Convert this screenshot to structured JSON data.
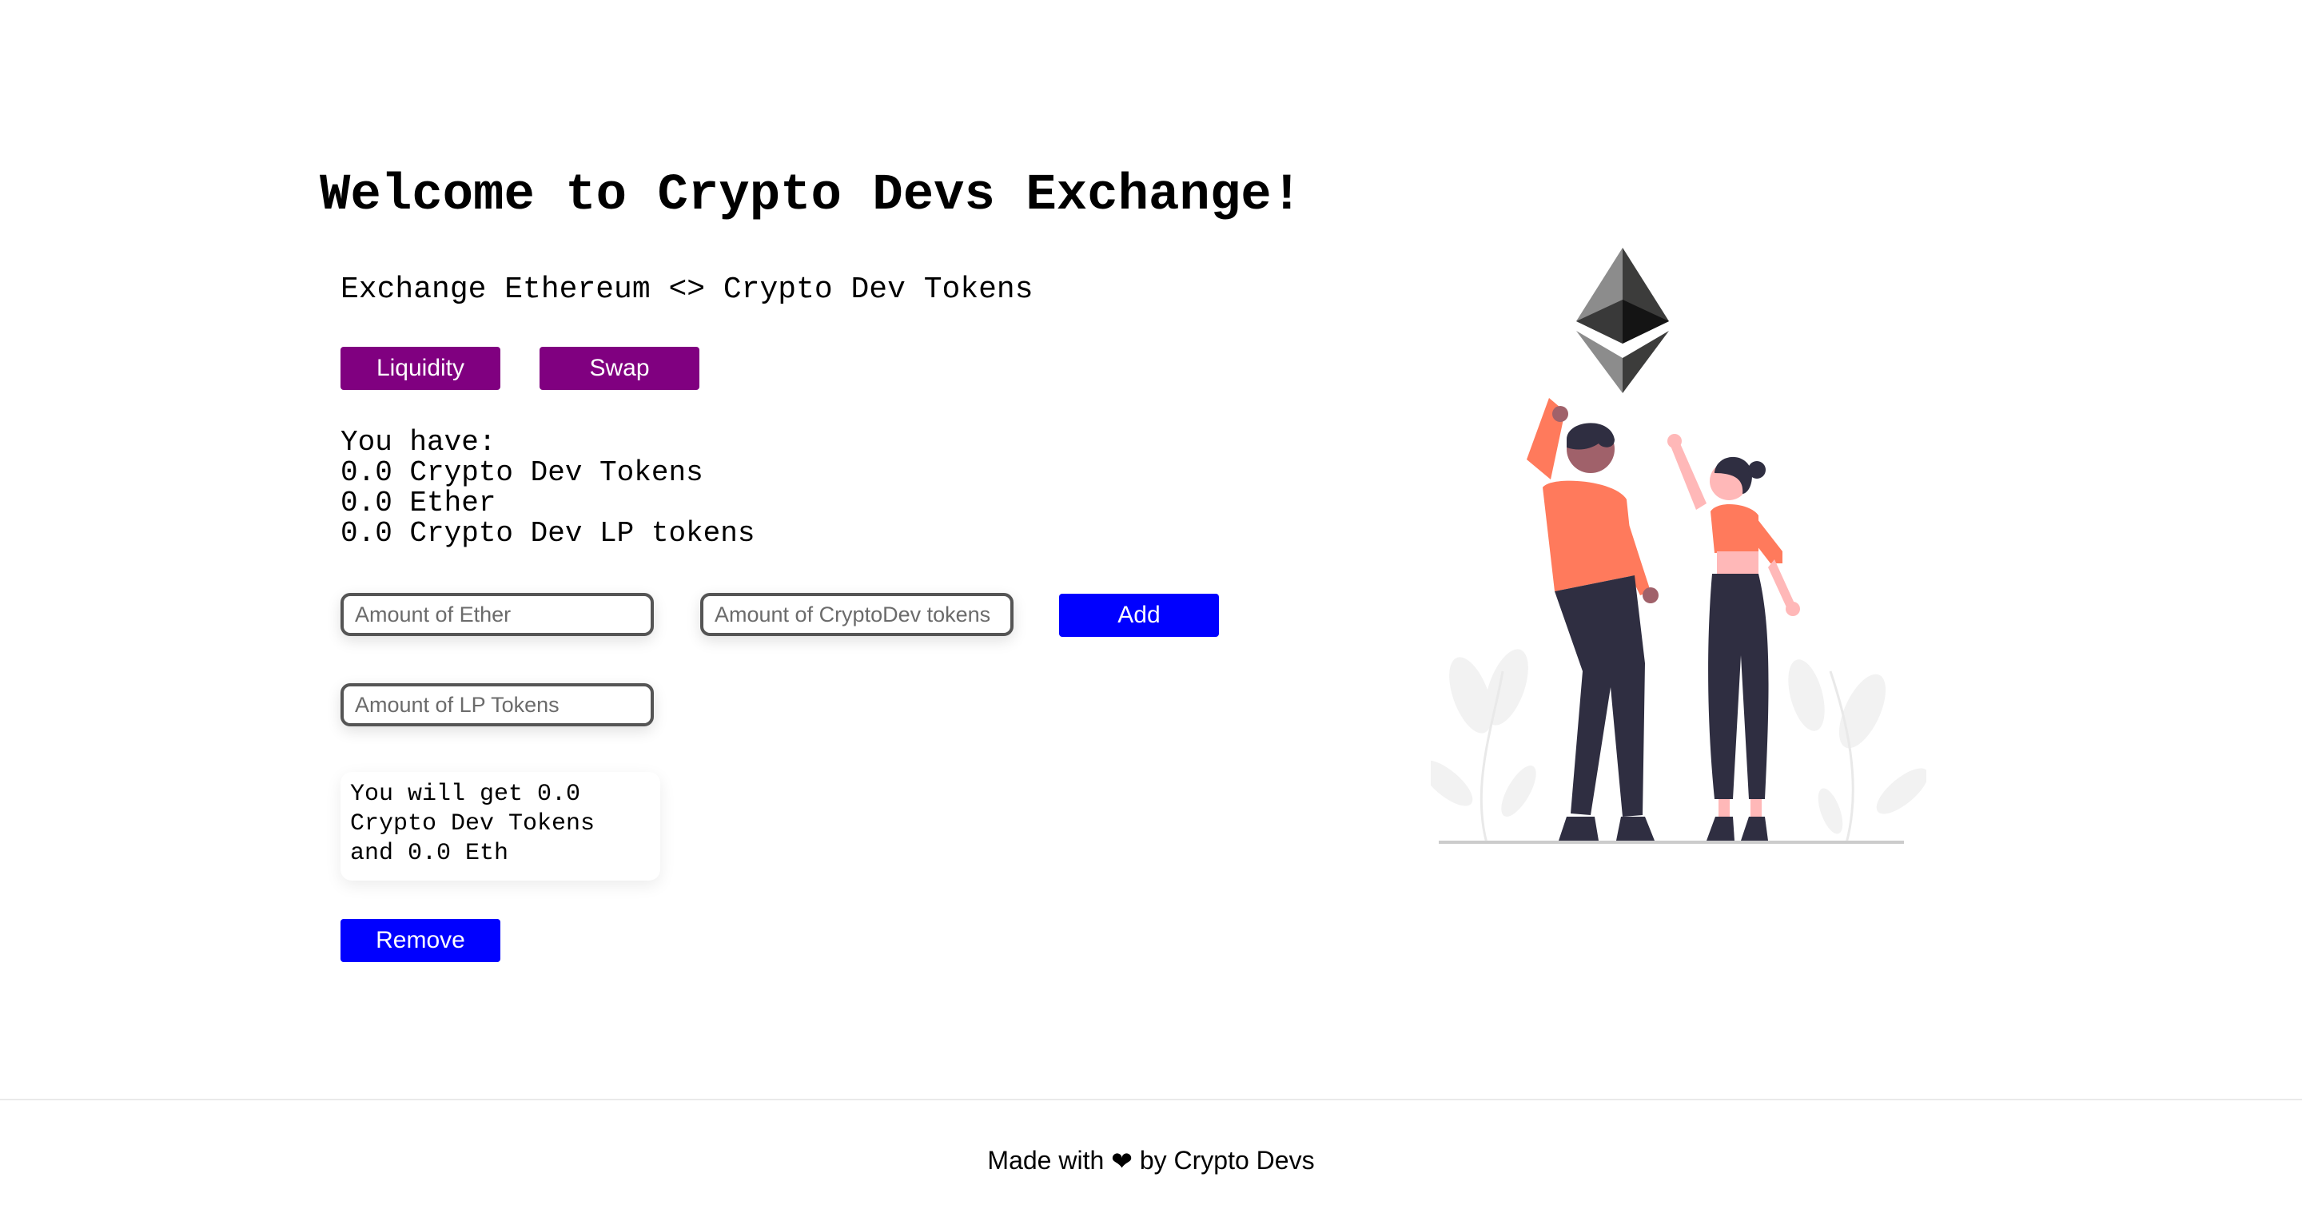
{
  "header": {
    "title": "Welcome to Crypto Devs Exchange!",
    "description": "Exchange Ethereum <> Crypto Dev Tokens"
  },
  "tabs": {
    "liquidity_label": "Liquidity",
    "swap_label": "Swap"
  },
  "balances": {
    "heading": "You have:",
    "crypto_dev_tokens": "0.0 Crypto Dev Tokens",
    "ether": "0.0 Ether",
    "lp_tokens": "0.0 Crypto Dev LP tokens"
  },
  "add_liquidity": {
    "ether_placeholder": "Amount of Ether",
    "cd_placeholder": "Amount of CryptoDev tokens",
    "add_label": "Add"
  },
  "remove_liquidity": {
    "lp_placeholder": "Amount of LP Tokens",
    "result_text": "You will get 0.0 Crypto Dev Tokens and 0.0 Eth",
    "remove_label": "Remove"
  },
  "footer": {
    "prefix": "Made with ",
    "heart": "❤",
    "suffix": " by Crypto Devs"
  },
  "colors": {
    "purple": "#800080",
    "blue": "#0000ff",
    "coral": "#ff7a5c",
    "navy": "#2f2e41"
  }
}
